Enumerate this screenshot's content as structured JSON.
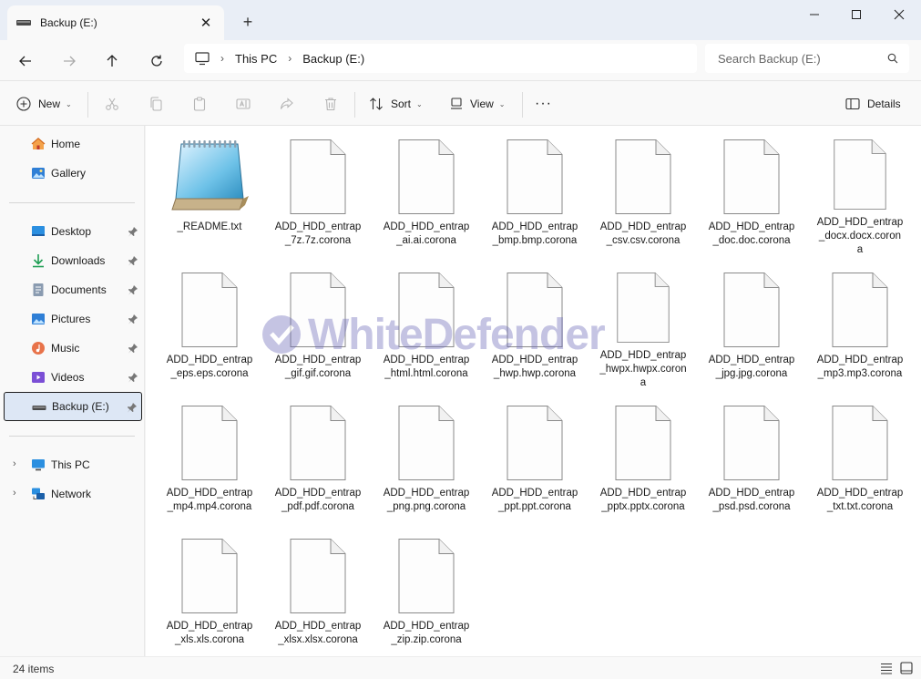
{
  "window": {
    "tab_title": "Backup (E:)",
    "tab_close": "✕",
    "new_tab": "+"
  },
  "nav": {
    "breadcrumb": [
      "This PC",
      "Backup (E:)"
    ],
    "breadcrumb_sep": "›",
    "search_placeholder": "Search Backup (E:)"
  },
  "toolbar": {
    "new_label": "New",
    "sort_label": "Sort",
    "view_label": "View",
    "more_label": "···",
    "details_label": "Details",
    "caret": "⌄"
  },
  "sidebar": {
    "quick": [
      {
        "label": "Home",
        "icon": "home-icon"
      },
      {
        "label": "Gallery",
        "icon": "gallery-icon"
      }
    ],
    "pinned": [
      {
        "label": "Desktop",
        "icon": "desktop-icon"
      },
      {
        "label": "Downloads",
        "icon": "downloads-icon"
      },
      {
        "label": "Documents",
        "icon": "documents-icon"
      },
      {
        "label": "Pictures",
        "icon": "pictures-icon"
      },
      {
        "label": "Music",
        "icon": "music-icon"
      },
      {
        "label": "Videos",
        "icon": "videos-icon"
      },
      {
        "label": "Backup (E:)",
        "icon": "drive-icon"
      }
    ],
    "tree": [
      {
        "label": "This PC",
        "icon": "pc-icon",
        "chev": "›"
      },
      {
        "label": "Network",
        "icon": "network-icon",
        "chev": "›"
      }
    ]
  },
  "files": [
    {
      "name": "_README.txt",
      "type": "notepad"
    },
    {
      "name": "ADD_HDD_entrap_7z.7z.corona",
      "type": "blank"
    },
    {
      "name": "ADD_HDD_entrap_ai.ai.corona",
      "type": "blank"
    },
    {
      "name": "ADD_HDD_entrap_bmp.bmp.corona",
      "type": "blank"
    },
    {
      "name": "ADD_HDD_entrap_csv.csv.corona",
      "type": "blank"
    },
    {
      "name": "ADD_HDD_entrap_doc.doc.corona",
      "type": "blank"
    },
    {
      "name": "ADD_HDD_entrap_docx.docx.corona",
      "type": "blank"
    },
    {
      "name": "ADD_HDD_entrap_eps.eps.corona",
      "type": "blank"
    },
    {
      "name": "ADD_HDD_entrap_gif.gif.corona",
      "type": "blank"
    },
    {
      "name": "ADD_HDD_entrap_html.html.corona",
      "type": "blank"
    },
    {
      "name": "ADD_HDD_entrap_hwp.hwp.corona",
      "type": "blank"
    },
    {
      "name": "ADD_HDD_entrap_hwpx.hwpx.corona",
      "type": "blank"
    },
    {
      "name": "ADD_HDD_entrap_jpg.jpg.corona",
      "type": "blank"
    },
    {
      "name": "ADD_HDD_entrap_mp3.mp3.corona",
      "type": "blank"
    },
    {
      "name": "ADD_HDD_entrap_mp4.mp4.corona",
      "type": "blank"
    },
    {
      "name": "ADD_HDD_entrap_pdf.pdf.corona",
      "type": "blank"
    },
    {
      "name": "ADD_HDD_entrap_png.png.corona",
      "type": "blank"
    },
    {
      "name": "ADD_HDD_entrap_ppt.ppt.corona",
      "type": "blank"
    },
    {
      "name": "ADD_HDD_entrap_pptx.pptx.corona",
      "type": "blank"
    },
    {
      "name": "ADD_HDD_entrap_psd.psd.corona",
      "type": "blank"
    },
    {
      "name": "ADD_HDD_entrap_txt.txt.corona",
      "type": "blank"
    },
    {
      "name": "ADD_HDD_entrap_xls.xls.corona",
      "type": "blank"
    },
    {
      "name": "ADD_HDD_entrap_xlsx.xlsx.corona",
      "type": "blank"
    },
    {
      "name": "ADD_HDD_entrap_zip.zip.corona",
      "type": "blank"
    }
  ],
  "watermark": {
    "text": "WhiteDefender"
  },
  "status": {
    "item_count": "24 items"
  },
  "colors": {
    "accent": "#0067c0",
    "selection": "#dde7f5",
    "watermark": "#6a67b8"
  }
}
